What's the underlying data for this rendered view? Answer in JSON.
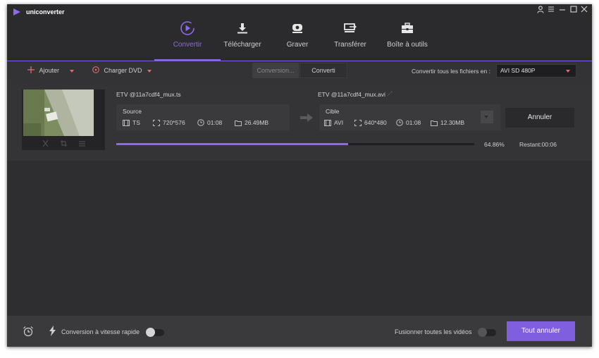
{
  "app": {
    "name": "uniconverter"
  },
  "nav": {
    "tabs": [
      {
        "label": "Convertir",
        "icon": "convert-icon",
        "active": true
      },
      {
        "label": "Télécharger",
        "icon": "download-icon",
        "active": false
      },
      {
        "label": "Graver",
        "icon": "burn-disc-icon",
        "active": false
      },
      {
        "label": "Transférer",
        "icon": "transfer-icon",
        "active": false
      },
      {
        "label": "Boîte à outils",
        "icon": "toolbox-icon",
        "active": false
      }
    ]
  },
  "toolbar": {
    "add_label": "Ajouter",
    "load_dvd_label": "Charger DVD",
    "segments": {
      "converting": "Conversion...",
      "converted": "Converti"
    },
    "convert_all_to_label": "Convertir tous les fichiers en :",
    "target_format": "AVI SD 480P"
  },
  "file": {
    "source_name": "ETV @11a7cdf4_mux.ts",
    "target_name": "ETV @11a7cdf4_mux.avi",
    "source": {
      "label": "Source",
      "format": "TS",
      "resolution": "720*576",
      "duration": "01:08",
      "size": "26.49MB"
    },
    "target": {
      "label": "Cible",
      "format": "AVI",
      "resolution": "640*480",
      "duration": "01:08",
      "size": "12.30MB"
    },
    "cancel_label": "Annuler",
    "progress": {
      "percent_value": 64.86,
      "percent_text": "64.86%",
      "remaining": "Restant:00:06"
    }
  },
  "footer": {
    "fast_conversion_label": "Conversion à vitesse rapide",
    "merge_label": "Fusionner toutes les vidéos",
    "cancel_all_label": "Tout annuler"
  },
  "colors": {
    "accent": "#8d6ae8",
    "background": "#2e2d2f",
    "caret": "#e56b6b"
  }
}
